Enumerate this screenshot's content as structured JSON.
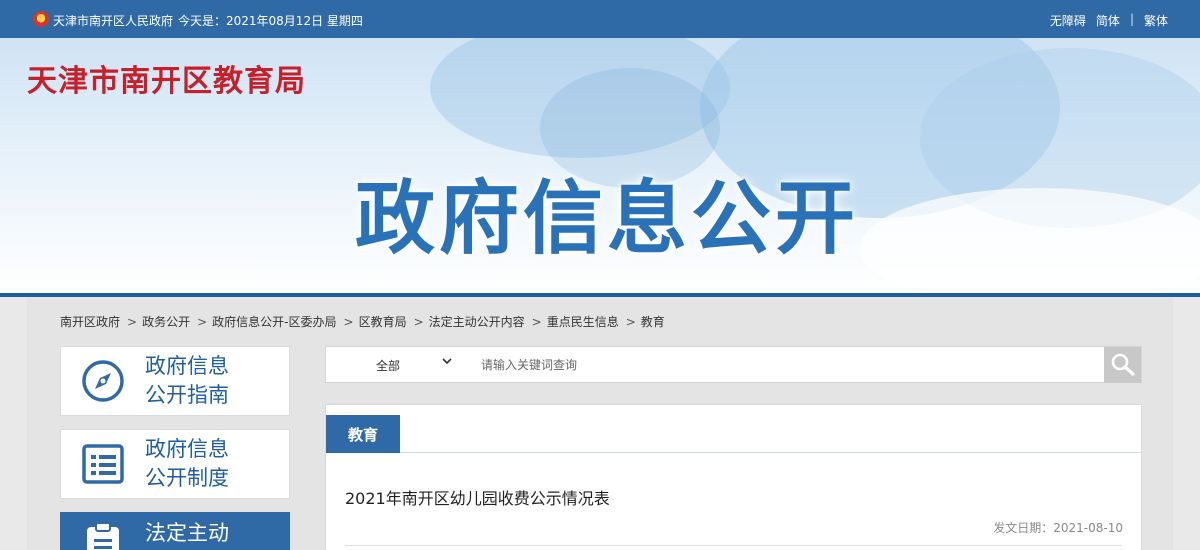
{
  "topbar": {
    "site_name": "天津市南开区人民政府",
    "today": "今天是：2021年08月12日 星期四",
    "links": [
      "无障碍",
      "简体",
      "繁体"
    ],
    "separator": "|"
  },
  "banner": {
    "bureau": "天津市南开区教育局",
    "headline": "政府信息公开"
  },
  "breadcrumb": {
    "items": [
      "南开区政府",
      "政务公开",
      "政府信息公开-区委办局",
      "区教育局",
      "法定主动公开内容",
      "重点民生信息",
      "教育"
    ],
    "arrow": ">"
  },
  "sidebar": {
    "items": [
      {
        "line1": "政府信息",
        "line2": "公开指南",
        "icon": "compass-icon"
      },
      {
        "line1": "政府信息",
        "line2": "公开制度",
        "icon": "document-list-icon"
      },
      {
        "line1": "法定主动",
        "line2": "",
        "icon": "clipboard-icon",
        "toggle": "-"
      }
    ]
  },
  "search": {
    "scope": "全部",
    "placeholder": "请输入关键词查询",
    "value": ""
  },
  "article": {
    "category": "教育",
    "title": "2021年南开区幼儿园收费公示情况表",
    "date": "发文日期：2021-08-10"
  },
  "colors": {
    "primary": "#2f6aa6",
    "bureau_red": "#c8202a",
    "headline_blue": "#2a72b8"
  }
}
